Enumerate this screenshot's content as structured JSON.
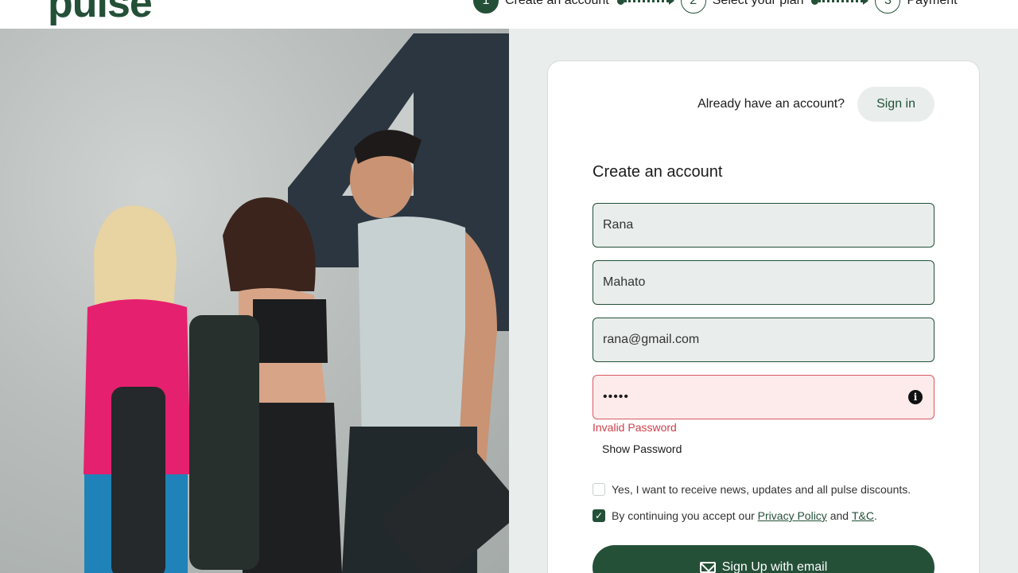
{
  "header": {
    "logo": "pulse",
    "steps": [
      {
        "number": "1",
        "label": "Create an account"
      },
      {
        "number": "2",
        "label": "Select your plan"
      },
      {
        "number": "3",
        "label": "Payment"
      }
    ]
  },
  "auth": {
    "prompt": "Already have an account?",
    "sign_in_label": "Sign in"
  },
  "form": {
    "title": "Create an account",
    "first_name": "Rana",
    "last_name": "Mahato",
    "email": "rana@gmail.com",
    "password_masked": "•••••",
    "password_error": "Invalid Password",
    "show_password_label": "Show Password",
    "newsletter_label": "Yes, I want to receive news, updates and all pulse discounts.",
    "terms_prefix": "By continuing you accept our",
    "privacy_link": "Privacy Policy",
    "terms_and": "and",
    "terms_link": "T&C",
    "terms_suffix": ".",
    "submit_label": "Sign Up with email"
  },
  "colors": {
    "brand": "#245038",
    "error": "#cf3f4a",
    "field_bg": "#e9eeec"
  }
}
